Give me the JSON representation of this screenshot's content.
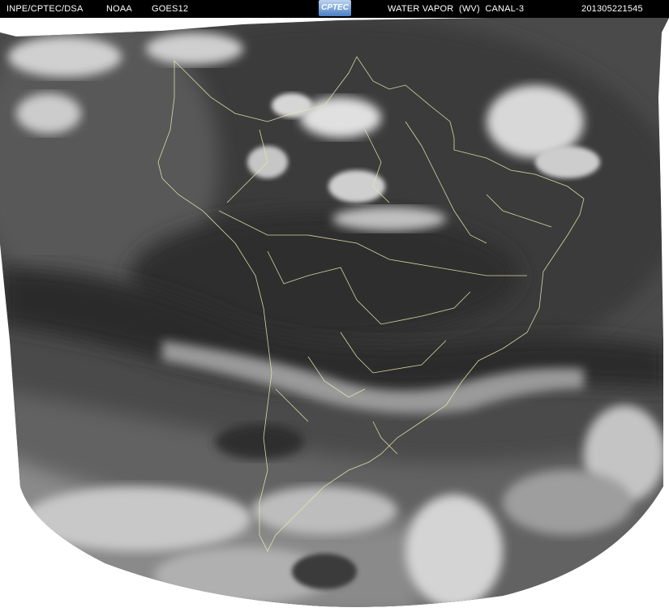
{
  "header": {
    "org": "INPE/CPTEC/DSA",
    "agency": "NOAA",
    "satellite": "GOES12",
    "logo_text": "CPTEC",
    "product": "WATER VAPOR  (WV)  CANAL-3",
    "timestamp": "201305221545"
  },
  "image": {
    "type": "satellite-water-vapor-image",
    "region": "south-america",
    "palette": {
      "background": "#ffffff",
      "dark": "#2e2e2e",
      "mid": "#6a6a6a",
      "bright": "#dcdcdc",
      "coastline": "#e8e8b0"
    }
  }
}
